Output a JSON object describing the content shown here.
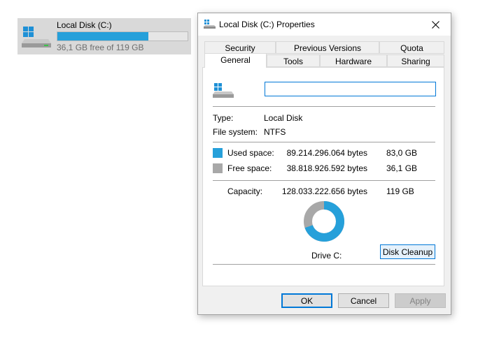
{
  "drive_tile": {
    "name": "Local Disk (C:)",
    "free_text": "36,1 GB free of 119 GB",
    "used_fraction": 0.697
  },
  "dialog": {
    "title": "Local Disk (C:) Properties",
    "tabs_row1": [
      "Security",
      "Previous Versions",
      "Quota"
    ],
    "tabs_row2": [
      "General",
      "Tools",
      "Hardware",
      "Sharing"
    ],
    "active_tab": "General",
    "volume_label_value": "",
    "type_label": "Type:",
    "type_value": "Local Disk",
    "fs_label": "File system:",
    "fs_value": "NTFS",
    "used": {
      "label": "Used space:",
      "bytes": "89.214.296.064 bytes",
      "size": "83,0 GB"
    },
    "free": {
      "label": "Free space:",
      "bytes": "38.818.926.592 bytes",
      "size": "36,1 GB"
    },
    "capacity": {
      "label": "Capacity:",
      "bytes": "128.033.222.656 bytes",
      "size": "119 GB"
    },
    "drive_caption": "Drive C:",
    "disk_cleanup_label": "Disk Cleanup",
    "ok_label": "OK",
    "cancel_label": "Cancel",
    "apply_label": "Apply"
  },
  "icons": [
    "windows-drive-icon",
    "drive-icon",
    "close-icon"
  ],
  "colors": {
    "used": "#26a0da",
    "free": "#a8a8a8",
    "accent": "#0078d7"
  }
}
